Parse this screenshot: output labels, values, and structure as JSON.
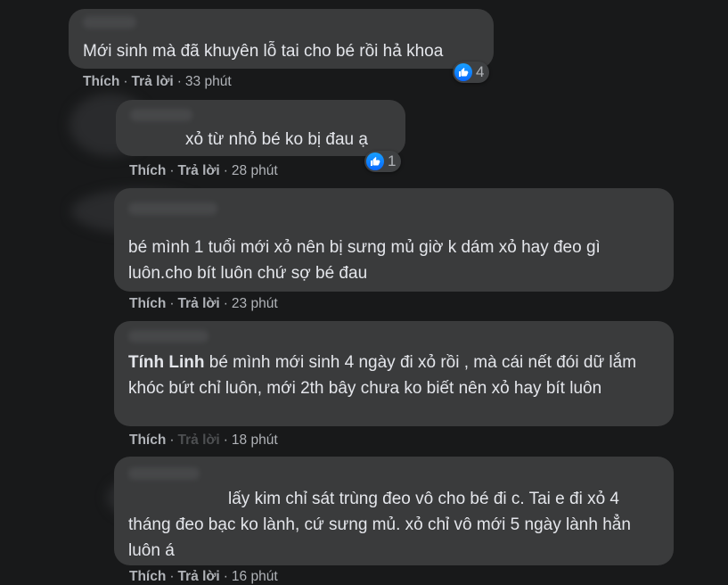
{
  "comments": [
    {
      "author": "",
      "text": "Mới sinh mà đã khuyên lỗ tai cho bé rồi hả khoa",
      "actions": {
        "like": "Thích",
        "reply": "Trả lời",
        "time": "33 phút"
      },
      "reactions": {
        "icon": "like-icon",
        "count": "4"
      }
    },
    {
      "author": "",
      "text": "xỏ từ nhỏ bé ko bị đau ạ",
      "actions": {
        "like": "Thích",
        "reply": "Trả lời",
        "time": "28 phút"
      },
      "reactions": {
        "icon": "like-icon",
        "count": "1"
      }
    },
    {
      "author": "",
      "text": "bé mình 1 tuổi mới xỏ nên bị sưng mủ giờ k dám xỏ hay đeo gì luôn.cho bít luôn chứ sợ bé đau",
      "actions": {
        "like": "Thích",
        "reply": "Trả lời",
        "time": "23 phút"
      }
    },
    {
      "author": "Tính Linh",
      "text": "bé mình mới sinh 4 ngày đi xỏ rồi , mà cái nết đói dữ lắm khóc bứt chỉ luôn, mới 2th bây chưa ko biết nên xỏ hay bít luôn",
      "actions": {
        "like": "Thích",
        "reply": "Trả lời",
        "time": "18 phút"
      }
    },
    {
      "author": "",
      "text": "lấy kim chỉ sát trùng đeo vô cho bé đi c. Tai e đi xỏ 4 tháng đeo bạc ko lành, cứ sưng mủ. xỏ chỉ vô mới 5 ngày lành hẳn luôn á",
      "actions": {
        "like": "Thích",
        "reply": "Trả lời",
        "time": "16 phút"
      }
    }
  ],
  "colors": {
    "background": "#18191a",
    "bubble": "#3a3b3c",
    "text": "#e4e6eb",
    "secondary": "#b0b3b8",
    "like_blue": "#1877f2"
  }
}
